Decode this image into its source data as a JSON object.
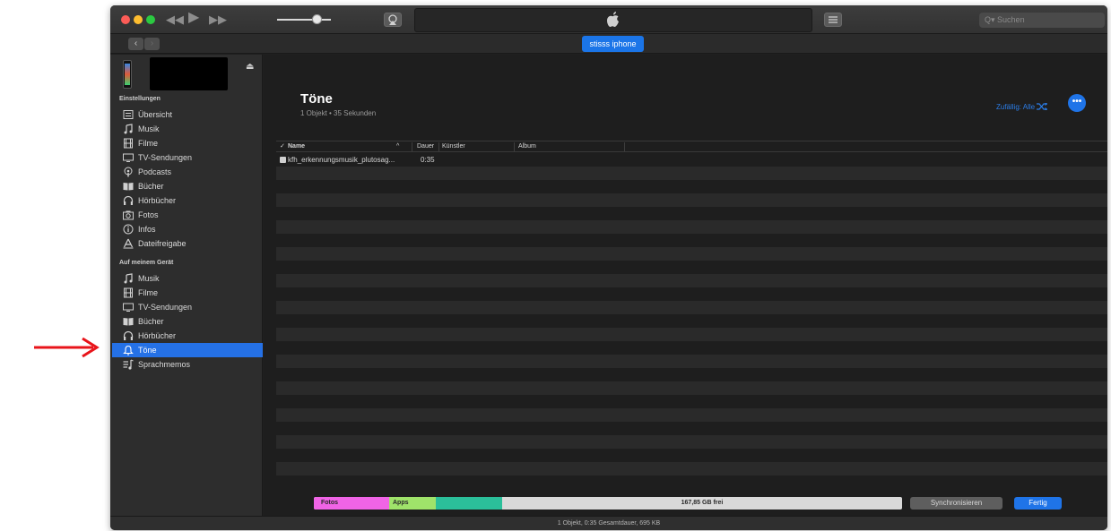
{
  "search": {
    "placeholder": "Suchen"
  },
  "nav": {
    "device_pill": "stisss iphone"
  },
  "sidebar": {
    "section_settings": "Einstellungen",
    "settings_items": [
      {
        "label": "Übersicht",
        "icon": "summary-icon"
      },
      {
        "label": "Musik",
        "icon": "music-note-icon"
      },
      {
        "label": "Filme",
        "icon": "film-icon"
      },
      {
        "label": "TV-Sendungen",
        "icon": "tv-icon"
      },
      {
        "label": "Podcasts",
        "icon": "podcast-icon"
      },
      {
        "label": "Bücher",
        "icon": "book-icon"
      },
      {
        "label": "Hörbücher",
        "icon": "headphones-icon"
      },
      {
        "label": "Fotos",
        "icon": "camera-icon"
      },
      {
        "label": "Infos",
        "icon": "info-icon"
      },
      {
        "label": "Dateifreigabe",
        "icon": "file-sharing-icon"
      }
    ],
    "section_device": "Auf meinem Gerät",
    "device_items": [
      {
        "label": "Musik",
        "icon": "music-note-icon"
      },
      {
        "label": "Filme",
        "icon": "film-icon"
      },
      {
        "label": "TV-Sendungen",
        "icon": "tv-icon"
      },
      {
        "label": "Bücher",
        "icon": "book-icon"
      },
      {
        "label": "Hörbücher",
        "icon": "headphones-icon"
      },
      {
        "label": "Töne",
        "icon": "bell-icon",
        "selected": true
      },
      {
        "label": "Sprachmemos",
        "icon": "voice-memo-icon"
      }
    ]
  },
  "main": {
    "title": "Töne",
    "subtitle": "1 Objekt • 35 Sekunden",
    "shuffle_label": "Zufällig: Alle",
    "more_label": "•••",
    "columns": {
      "name": "Name",
      "duration": "Dauer",
      "artist": "Künstler",
      "album": "Album"
    },
    "rows": [
      {
        "name": "kfh_erkennungsmusik_plutosag...",
        "duration": "0:35",
        "artist": "",
        "album": ""
      }
    ]
  },
  "capacity": {
    "segments": [
      {
        "label": "Fotos",
        "color": "#f064e6"
      },
      {
        "label": "Apps",
        "color": "#9fe36a"
      },
      {
        "label": "",
        "color": "#2bbf9a"
      }
    ],
    "free_label": "167,85 GB frei"
  },
  "buttons": {
    "sync": "Synchronisieren",
    "done": "Fertig"
  },
  "status": "1 Objekt, 0:35 Gesamtdauer, 695 KB",
  "colors": {
    "accent": "#1f74e8",
    "selection": "#2571e6",
    "annotation_arrow": "#e8141a"
  }
}
